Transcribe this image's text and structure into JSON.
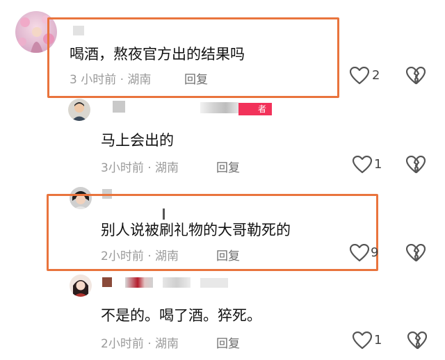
{
  "comments": [
    {
      "text": "喝酒，熬夜官方出的结果吗",
      "meta": "3 小时前 · 湖南",
      "reply_label": "回复",
      "likes": "2"
    },
    {
      "text": "马上会出的",
      "meta": "3小时前 · 湖南",
      "reply_label": "回复",
      "likes": "1",
      "badge": "者"
    },
    {
      "text": "别人说被刷礼物的大哥勒死的",
      "meta": "2小时前 · 湖南",
      "reply_label": "回复",
      "likes": "9"
    },
    {
      "text": "不是的。喝了酒。猝死。",
      "meta": "2小时前 · 湖南",
      "reply_label": "回复",
      "likes": "1"
    }
  ],
  "colors": {
    "highlight": "#e9743d",
    "meta_text": "#9a9a9a",
    "badge": "#f2325a"
  },
  "icons": [
    "heart-icon",
    "broken-heart-icon",
    "avatar"
  ]
}
